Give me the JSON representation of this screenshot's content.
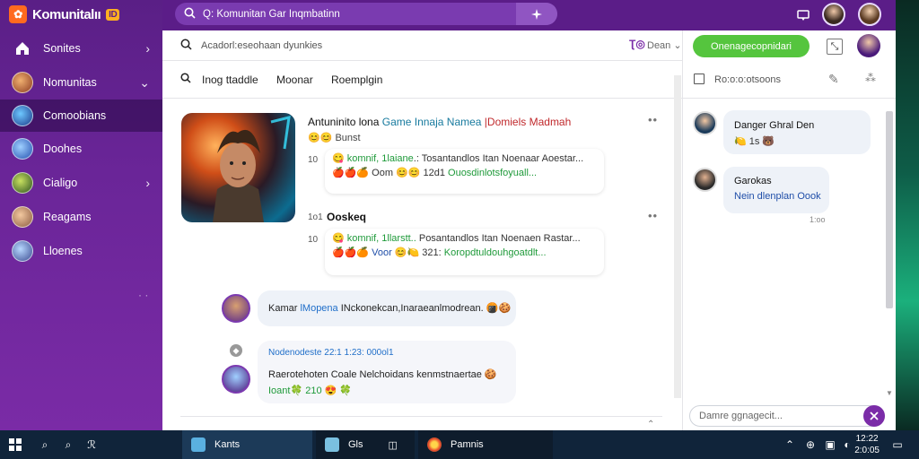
{
  "app": {
    "brand": "Komunitalıı",
    "brand_badge": "ID"
  },
  "sidebar": {
    "items": [
      {
        "label": "Sonites",
        "chevron": "›"
      },
      {
        "label": "Nomunitas",
        "chevron": "⌄"
      },
      {
        "label": "Comoobians",
        "chevron": ""
      },
      {
        "label": "Doohes",
        "chevron": ""
      },
      {
        "label": "Cialigo",
        "chevron": "›"
      },
      {
        "label": "Reagams",
        "chevron": ""
      },
      {
        "label": "Lloenes",
        "chevron": ""
      }
    ],
    "dots": "· ·"
  },
  "topbar": {
    "search_text": "Q: Komunitan Gar Inqmbatinn"
  },
  "main": {
    "search_placeholder": "Acadorl:eseohaan dyunkies",
    "tabs": [
      "Inog ttaddle",
      "Moonar",
      "Roemplgin"
    ],
    "post": {
      "title_part1": "Antuninito lona",
      "title_part2": " Game Innaja Namea",
      "title_part3": " |Domiels Madmah",
      "subtitle_emoji": "😊😊",
      "subtitle": " Bunst",
      "replies": [
        {
          "num": "10",
          "line1_a": "😋 ",
          "line1_green": "komnif, 1laiane",
          "line1_b": ".: Tosantandlos Itan Noenaar Aoestar...",
          "line2_a": "🍎🍎🍊 Oom 😊😊 12d1  ",
          "line2_green": "Ouosdinlotsfoyuall..."
        },
        {
          "num": "10",
          "line1_a": "😋 ",
          "line1_green": "komnif, 1llarstt..",
          "line1_b": " Posantandlos Itan Noenaen Rastar...",
          "line2_a": "🍎🍎🍊 ",
          "line2_blue": "Voor",
          "line2_b": " 😊🍋 321: ",
          "line2_green": "Koropdtuldouhgoatdlt..."
        }
      ],
      "second_title_num": "1o1",
      "second_title": "Ooskeq"
    },
    "messages": [
      {
        "text_a": "Kamar ",
        "text_blue": "lMopena",
        "text_b": " INckonekcan,Inaraeanlmodrean. 🍘🍪"
      },
      {
        "meta": "Nodenodeste 22:1 1:23: 000ol1",
        "line1": "Raerotehoten Coale Nelchoidans kenmstnaertae 🍪",
        "line2_green": "Ioant🍀 210",
        "line2_b": " 😍 🍀"
      }
    ]
  },
  "right": {
    "tab_label": "Ro:o:o:otsoons",
    "cta": "Onenagecopnidari",
    "messages": [
      {
        "name": "Danger Ghral Den",
        "line": "🍋 1s 🐻"
      },
      {
        "name": "Garokas",
        "line": "Nein dlenplan Oook",
        "time": "1:oo"
      }
    ],
    "compose_placeholder": "Damre ggnagecit..."
  },
  "taskbar": {
    "apps": [
      "Kants",
      "Gls",
      "Pamnis"
    ],
    "clock_time": "12:22",
    "clock_date": "2:0:05"
  },
  "colors": {
    "sidebar": "#6a2598",
    "topbar": "#5b1d88",
    "accent_green": "#55c53e",
    "send": "#7b2ca8",
    "taskbar": "#10243a"
  },
  "icons": [
    "home-icon",
    "search-icon",
    "chat-icon",
    "gear-icon",
    "send-icon",
    "share-icon",
    "edit-icon",
    "windows-icon"
  ]
}
